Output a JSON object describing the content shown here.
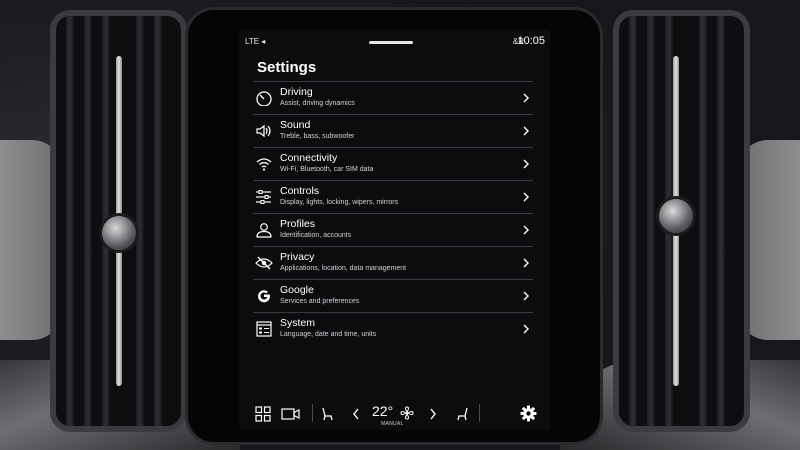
{
  "status": {
    "left": "LTE ◂",
    "right": "&R",
    "time": "10:05"
  },
  "settings": {
    "title": "Settings",
    "items": [
      {
        "label": "Driving",
        "sub": "Assist, driving dynamics",
        "icon": "speedometer-icon"
      },
      {
        "label": "Sound",
        "sub": "Treble, bass, subwoofer",
        "icon": "speaker-icon"
      },
      {
        "label": "Connectivity",
        "sub": "Wi-Fi, Bluetooth, car SIM data",
        "icon": "wifi-icon"
      },
      {
        "label": "Controls",
        "sub": "Display, lights, locking, wipers, mirrors",
        "icon": "sliders-icon"
      },
      {
        "label": "Profiles",
        "sub": "Identification, accounts",
        "icon": "person-icon"
      },
      {
        "label": "Privacy",
        "sub": "Applications, location, data management",
        "icon": "eye-slash-icon"
      },
      {
        "label": "Google",
        "sub": "Services and preferences",
        "icon": "google-icon"
      },
      {
        "label": "System",
        "sub": "Language, date and time, units",
        "icon": "system-icon"
      }
    ]
  },
  "climate": {
    "temperature": "22°",
    "mode": "MANUAL"
  },
  "colors": {
    "screen_bg": "#0c0c0f",
    "text": "#ffffff",
    "divider": "#3a3a40"
  }
}
